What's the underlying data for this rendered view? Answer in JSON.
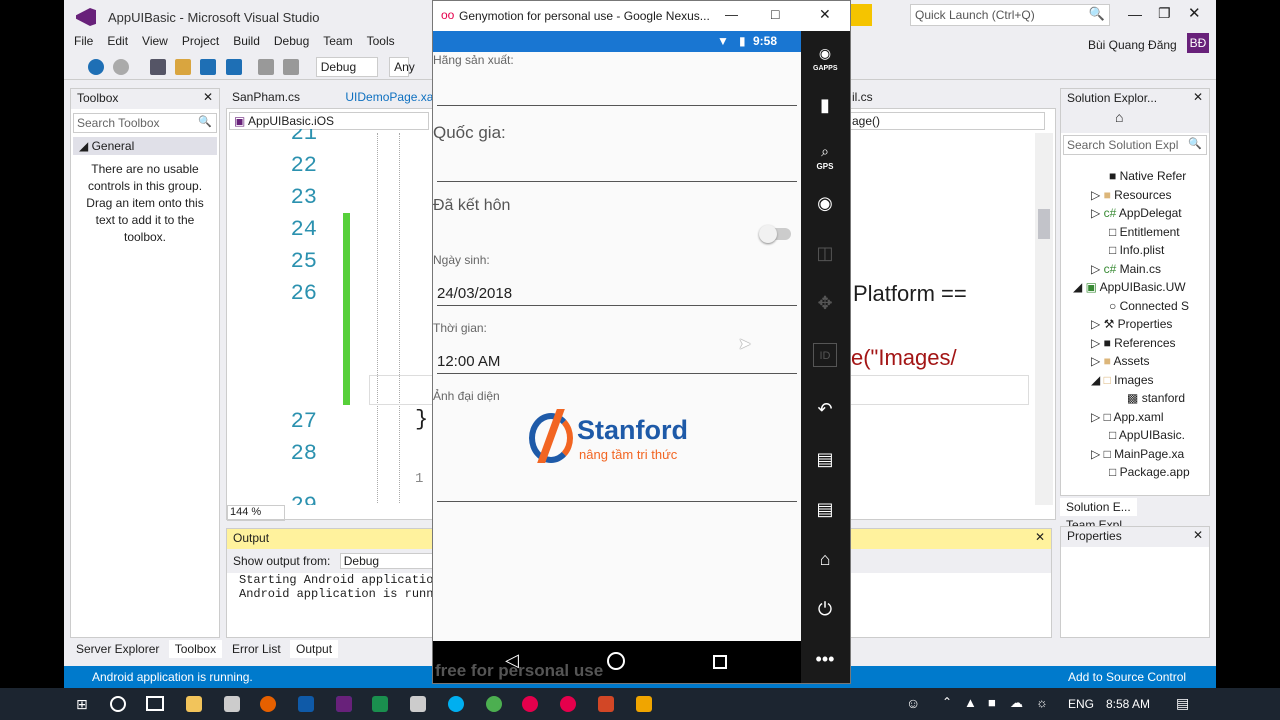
{
  "vs": {
    "title": "AppUIBasic - Microsoft Visual Studio",
    "quick_launch": "Quick Launch (Ctrl+Q)",
    "user": "Bùi Quang Đăng",
    "user_initials": "BĐ",
    "menu": [
      "File",
      "Edit",
      "View",
      "Project",
      "Build",
      "Debug",
      "Team",
      "Tools"
    ],
    "config": "Debug",
    "platform": "Any",
    "toolbox": {
      "title": "Toolbox",
      "search": "Search Toolbox",
      "group": "General",
      "empty_text": "There are no usable controls in this group. Drag an item onto this text to add it to the toolbox."
    },
    "doc_tabs": [
      "SanPham.cs",
      "UIDemoPage.xa",
      "il.cs"
    ],
    "project_combo": "AppUIBasic.iOS",
    "member_combo": "age()",
    "line_numbers": [
      "21",
      "22",
      "23",
      "24",
      "25",
      "26",
      "27",
      "28",
      "29"
    ],
    "code_fragments": [
      "Platform ==",
      "e(\"Images/",
      "}",
      "1 r"
    ],
    "zoom": "144 %",
    "output": {
      "title": "Output",
      "show_from_label": "Show output from:",
      "show_from_value": "Debug",
      "lines": [
        "Starting Android application",
        "Android application is runnin"
      ]
    },
    "bottom_tabs_left": [
      "Server Explorer",
      "Toolbox"
    ],
    "bottom_tabs_output": [
      "Error List",
      "Output"
    ],
    "solution": {
      "title": "Solution Explor...",
      "search": "Search Solution Expl",
      "items": [
        "Native Refer",
        "Resources",
        "AppDelegat",
        "Entitlement",
        "Info.plist",
        "Main.cs",
        "AppUIBasic.UW",
        "Connected S",
        "Properties",
        "References",
        "Assets",
        "Images",
        "stanford",
        "App.xaml",
        "AppUIBasic.",
        "MainPage.xa",
        "Package.app"
      ],
      "tabs": [
        "Solution E...",
        "Team Expl..."
      ]
    },
    "properties_title": "Properties",
    "status_left": "Android application is running.",
    "status_right": "Add to Source Control"
  },
  "emulator": {
    "title": "Genymotion for personal use - Google Nexus...",
    "time": "9:58",
    "watermark": "free for personal use",
    "fields": {
      "manufacturer_label": "Hãng sản xuất:",
      "country_label": "Quốc gia:",
      "married_label": "Đã kết hôn",
      "birth_label": "Ngày sinh:",
      "birth_value": "24/03/2018",
      "time_label": "Thời gian:",
      "time_value": "12:00 AM",
      "avatar_label": "Ảnh đại diện"
    },
    "logo": {
      "name": "Stanford",
      "tagline": "nâng tầm tri thức"
    },
    "side_labels": [
      "GAPPS",
      "GPS",
      "ID"
    ]
  },
  "taskbar": {
    "lang": "ENG",
    "time": "8:58 AM"
  },
  "colors": {
    "vs_accent": "#68217a",
    "status_bar": "#007acc",
    "android_blue": "#1976d2",
    "stanford_blue": "#1e5aa8",
    "stanford_orange": "#f26522",
    "code_green": "#57d03a",
    "output_header": "#fff29d"
  }
}
